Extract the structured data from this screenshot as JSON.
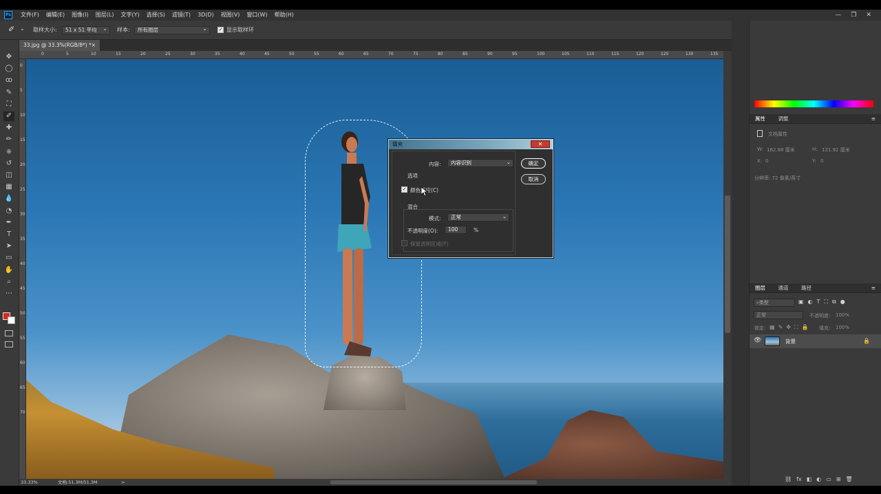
{
  "app": {
    "logo": "Ps",
    "menu": [
      "文件(F)",
      "编辑(E)",
      "图像(I)",
      "图层(L)",
      "文字(Y)",
      "选择(S)",
      "滤镜(T)",
      "3D(D)",
      "视图(V)",
      "窗口(W)",
      "帮助(H)"
    ],
    "window_controls": [
      "—",
      "❐",
      "✕"
    ]
  },
  "options_bar": {
    "sample_size_label": "取样大小:",
    "sample_size_value": "51 x 51 平均",
    "sample_label": "样本:",
    "sample_value": "所有图层",
    "show_ring_label": "显示取样环",
    "show_ring_checked": true
  },
  "document": {
    "tab_title": "33.jpg @ 33.3%(RGB/8*) *",
    "tab_close": "×",
    "zoom": "33.33%",
    "doc_info": "文档:51.3M/51.3M",
    "status_arrow": ">"
  },
  "ruler": {
    "h_ticks": [
      "0",
      "5",
      "10",
      "15",
      "20",
      "25",
      "30",
      "35",
      "40",
      "45",
      "50",
      "55",
      "60",
      "65",
      "70",
      "75",
      "80",
      "85",
      "90",
      "95",
      "100",
      "105",
      "110",
      "115",
      "120",
      "125",
      "130",
      "135"
    ],
    "v_ticks": [
      "0",
      "5",
      "10",
      "15",
      "20",
      "25",
      "30",
      "35",
      "40",
      "45",
      "50",
      "55",
      "60",
      "65",
      "70"
    ]
  },
  "tools": [
    "move-icon",
    "marquee-icon",
    "lasso-icon",
    "quick-select-icon",
    "crop-icon",
    "eyedropper-icon",
    "healing-icon",
    "brush-icon",
    "stamp-icon",
    "history-brush-icon",
    "eraser-icon",
    "gradient-icon",
    "blur-icon",
    "dodge-icon",
    "pen-icon",
    "type-icon",
    "path-select-icon",
    "shape-icon",
    "hand-icon",
    "zoom-icon",
    "more-icon"
  ],
  "tool_glyphs": [
    "✥",
    "◯",
    "ꝏ",
    "✎",
    "⛶",
    "✐",
    "✚",
    "✏",
    "⎈",
    "↺",
    "◫",
    "▦",
    "💧",
    "◔",
    "✒",
    "T",
    "➤",
    "▭",
    "✋",
    "⌕",
    "⋯"
  ],
  "colors": {
    "foreground": "#d42a20",
    "background": "#ffffff",
    "accent": "#31a8ff"
  },
  "properties_panel": {
    "tabs": [
      "属性",
      "调整"
    ],
    "doc_props": "文档属性",
    "w_label": "W:",
    "w_value": "162.88 厘米",
    "h_label": "H:",
    "h_value": "121.92 厘米",
    "x_label": "X:",
    "x_value": "0",
    "y_label": "Y:",
    "y_value": "0",
    "resolution": "分辨率: 72 像素/英寸"
  },
  "layers_panel": {
    "tabs": [
      "图层",
      "通道",
      "路径"
    ],
    "filter_placeholder": "类型",
    "blend_mode": "正常",
    "opacity_label": "不透明度:",
    "opacity_value": "100%",
    "lock_label": "锁定:",
    "fill_label": "填充:",
    "fill_value": "100%",
    "layer_name": "背景",
    "footer_icons": [
      "⛓",
      "fx",
      "◧",
      "◐",
      "▭",
      "⊞",
      "🗑"
    ]
  },
  "fill_dialog": {
    "title": "填充",
    "close": "✕",
    "content_label": "内容:",
    "content_value": "内容识别",
    "options_label": "选项",
    "color_adapt_label": "颜色适应(C)",
    "color_adapt_checked": true,
    "blend_section": "混合",
    "mode_label": "模式:",
    "mode_value": "正常",
    "opacity_label": "不透明度(O):",
    "opacity_value": "100",
    "opacity_unit": "%",
    "preserve_label": "保留透明区域(P)",
    "ok_button": "确定",
    "cancel_button": "取消"
  }
}
